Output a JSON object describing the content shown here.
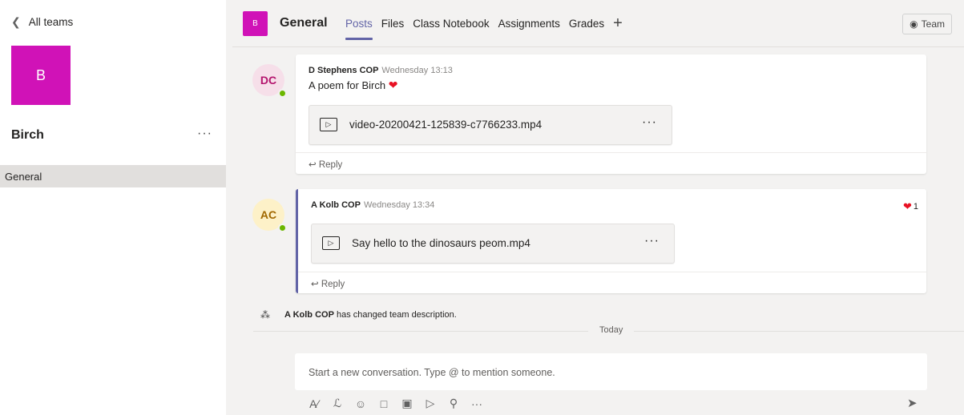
{
  "sidebar": {
    "back_label": "All teams",
    "team_initial": "B",
    "team_name": "Birch",
    "more": "···",
    "channels": [
      {
        "label": "General"
      }
    ]
  },
  "header": {
    "tile_initial": "B",
    "channel_title": "General",
    "tabs": [
      {
        "label": "Posts"
      },
      {
        "label": "Files"
      },
      {
        "label": "Class Notebook"
      },
      {
        "label": "Assignments"
      },
      {
        "label": "Grades"
      }
    ],
    "add_tab": "+",
    "team_button": "Team"
  },
  "posts": [
    {
      "initials": "DC",
      "author": "D Stephens COP",
      "time": "Wednesday 13:13",
      "text": "A poem for Birch",
      "file": "video-20200421-125839-c7766233.mp4",
      "reply": "Reply"
    },
    {
      "initials": "AC",
      "author": "A Kolb COP",
      "time": "Wednesday 13:34",
      "file": "Say hello to the dinosaurs peom.mp4",
      "reply": "Reply",
      "reaction_count": "1"
    }
  ],
  "system_message": {
    "actor": "A Kolb COP",
    "text": "has changed team description."
  },
  "divider_label": "Today",
  "compose": {
    "placeholder": "Start a new conversation. Type @ to mention someone."
  },
  "colors": {
    "accent": "#6264a7",
    "team_tile": "#d012b7",
    "presence": "#6bb700",
    "heart": "#e81123"
  },
  "toolbar_icons": [
    "format-icon",
    "attach-icon",
    "emoji-icon",
    "sticker-icon",
    "meet-now-icon",
    "stream-icon",
    "praise-icon",
    "more-options-icon"
  ]
}
